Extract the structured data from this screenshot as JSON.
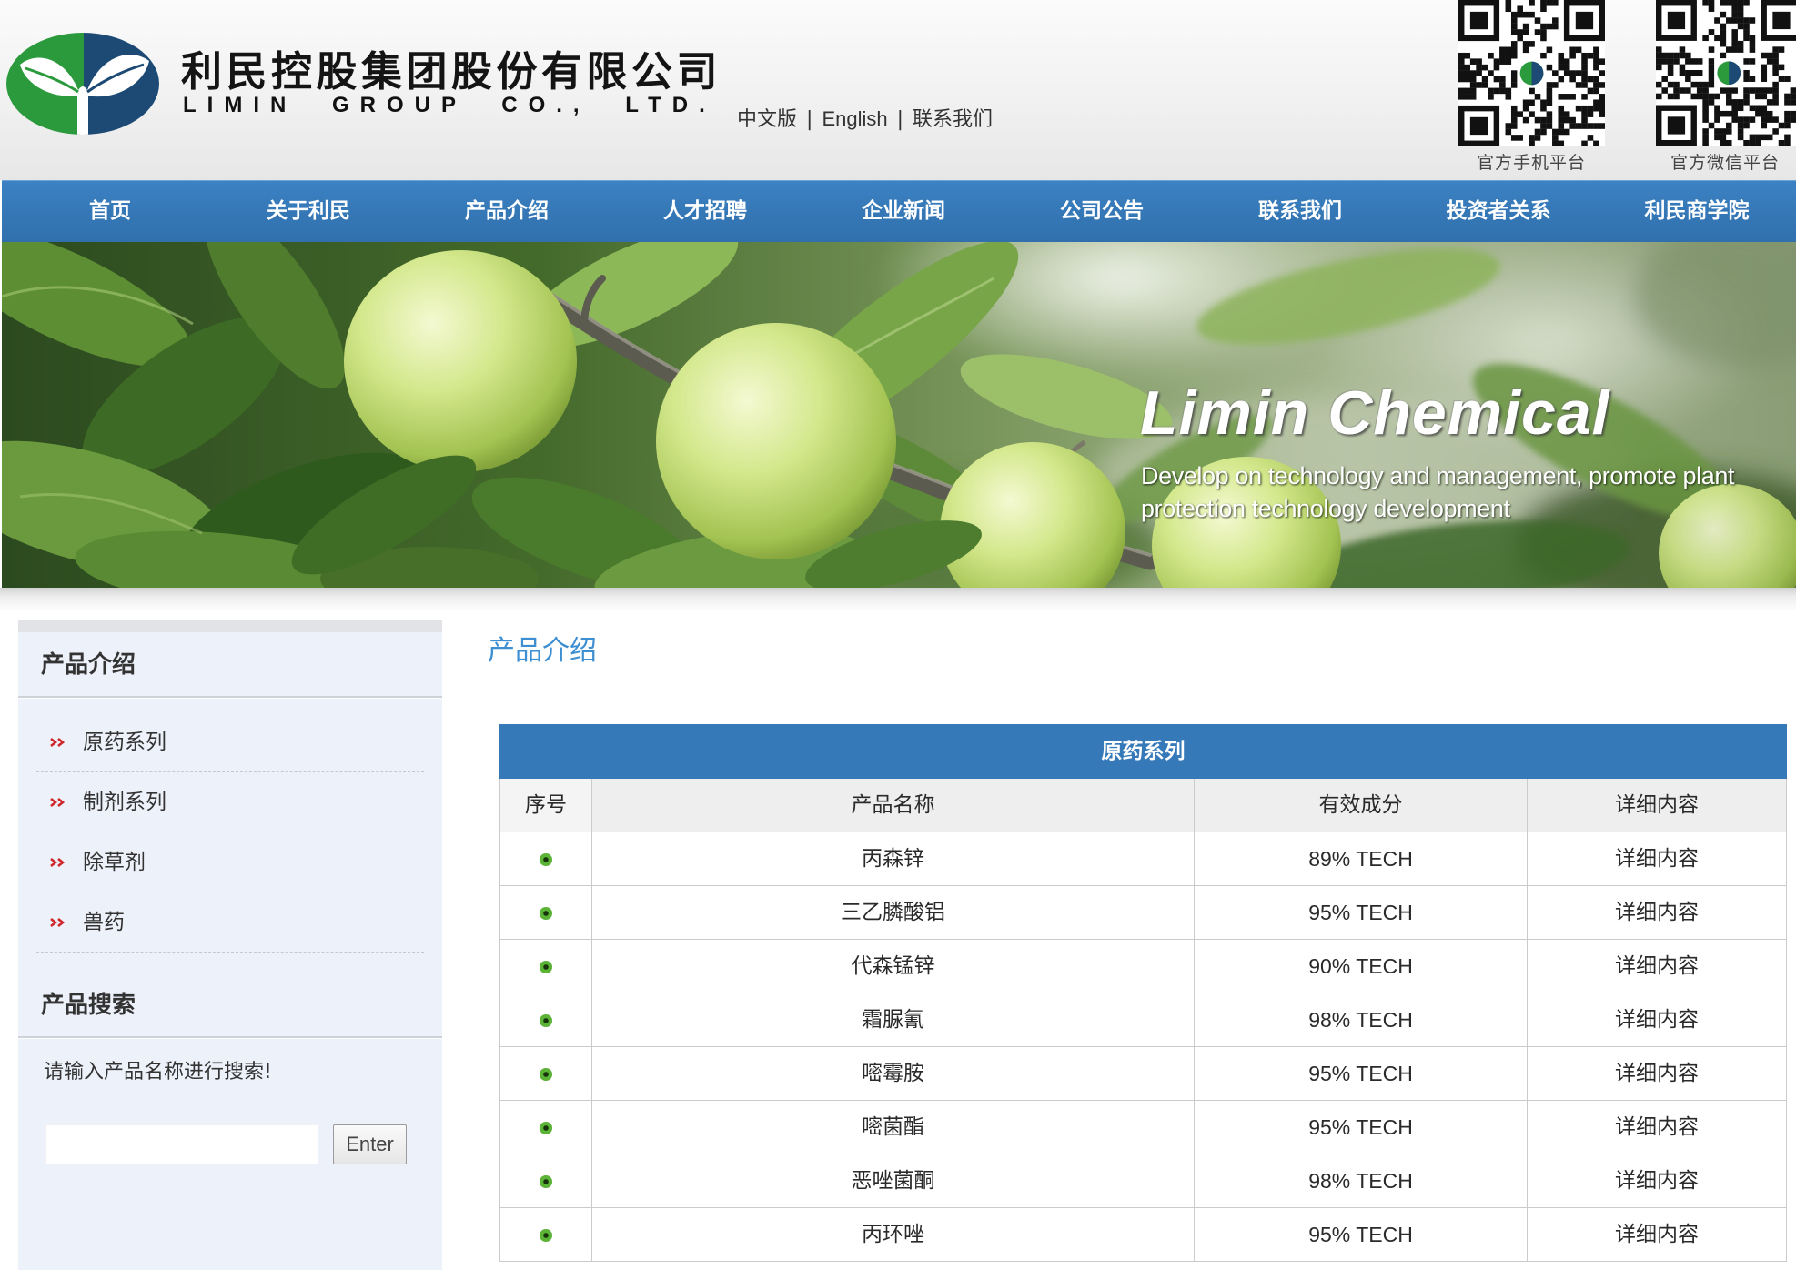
{
  "header": {
    "company_name_cn": "利民控股集团股份有限公司",
    "company_name_en": "LIMIN GROUP CO., LTD.",
    "lang_links": {
      "chinese": "中文版",
      "english": "English",
      "contact": "联系我们"
    },
    "separator": "|",
    "qr_codes": [
      {
        "label": "官方手机平台"
      },
      {
        "label": "官方微信平台"
      }
    ]
  },
  "nav": {
    "items": [
      "首页",
      "关于利民",
      "产品介绍",
      "人才招聘",
      "企业新闻",
      "公司公告",
      "联系我们",
      "投资者关系",
      "利民商学院"
    ]
  },
  "banner": {
    "title": "Limin Chemical",
    "subtitle_lines": [
      "Develop on technology and management, promote plant",
      "protection technology development"
    ]
  },
  "sidebar": {
    "product_section": {
      "title": "产品介绍",
      "categories": [
        "原药系列",
        "制剂系列",
        "除草剂",
        "兽药"
      ]
    },
    "search": {
      "title": "产品搜索",
      "hint": "请输入产品名称进行搜索!",
      "value": "",
      "button_label": "Enter"
    }
  },
  "main": {
    "page_title": "产品介绍",
    "table": {
      "caption": "原药系列",
      "headers": [
        "序号",
        "产品名称",
        "有效成分",
        "详细内容"
      ],
      "rows": [
        {
          "name": "丙森锌",
          "ingredient": "89% TECH",
          "detail": "详细内容"
        },
        {
          "name": "三乙膦酸铝",
          "ingredient": "95% TECH",
          "detail": "详细内容"
        },
        {
          "name": "代森锰锌",
          "ingredient": "90% TECH",
          "detail": "详细内容"
        },
        {
          "name": "霜脲氰",
          "ingredient": "98% TECH",
          "detail": "详细内容"
        },
        {
          "name": "嘧霉胺",
          "ingredient": "95% TECH",
          "detail": "详细内容"
        },
        {
          "name": "嘧菌酯",
          "ingredient": "95% TECH",
          "detail": "详细内容"
        },
        {
          "name": "恶唑菌酮",
          "ingredient": "98% TECH",
          "detail": "详细内容"
        },
        {
          "name": "丙环唑",
          "ingredient": "95% TECH",
          "detail": "详细内容"
        }
      ]
    }
  },
  "icons": {
    "logo": "limin-logo-icon",
    "qr": "qr-code-icon",
    "sidebar_bullet": "double-chevron-right-icon",
    "row_marker": "green-dot-icon"
  },
  "colors": {
    "nav_bg": "#3679b8",
    "accent": "#3d8fd2",
    "sidebar_bg": "#edf1f9",
    "bullet_red": "#d0272b",
    "table_caption_bg": "#3679b8",
    "logo_green": "#2b9a3d",
    "logo_navy": "#1c4a74"
  }
}
